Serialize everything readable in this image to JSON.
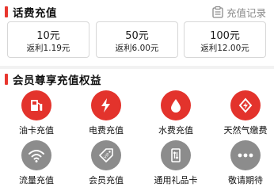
{
  "topup": {
    "title": "话费充值",
    "records_label": "充值记录",
    "options": [
      {
        "amount": "10元",
        "rebate": "返利1.19元"
      },
      {
        "amount": "50元",
        "rebate": "返利6.00元"
      },
      {
        "amount": "100元",
        "rebate": "返利12.00元"
      }
    ]
  },
  "benefits": {
    "title": "会员尊享充值权益",
    "items": [
      {
        "label": "油卡充值",
        "icon": "fuel-pump-icon",
        "color": "#e3332c"
      },
      {
        "label": "电费充值",
        "icon": "lightning-icon",
        "color": "#e3332c"
      },
      {
        "label": "水费充值",
        "icon": "water-drop-icon",
        "color": "#e3332c"
      },
      {
        "label": "天然气缴费",
        "icon": "gas-flame-icon",
        "color": "#e3332c"
      },
      {
        "label": "流量充值",
        "icon": "wifi-icon",
        "color": "#8c8c8c"
      },
      {
        "label": "会员充值",
        "icon": "vip-tag-icon",
        "color": "#8c8c8c"
      },
      {
        "label": "通用礼品卡",
        "icon": "gift-card-icon",
        "color": "#8c8c8c"
      },
      {
        "label": "敬请期待",
        "icon": "more-dots-icon",
        "color": "#8c8c8c"
      }
    ]
  }
}
